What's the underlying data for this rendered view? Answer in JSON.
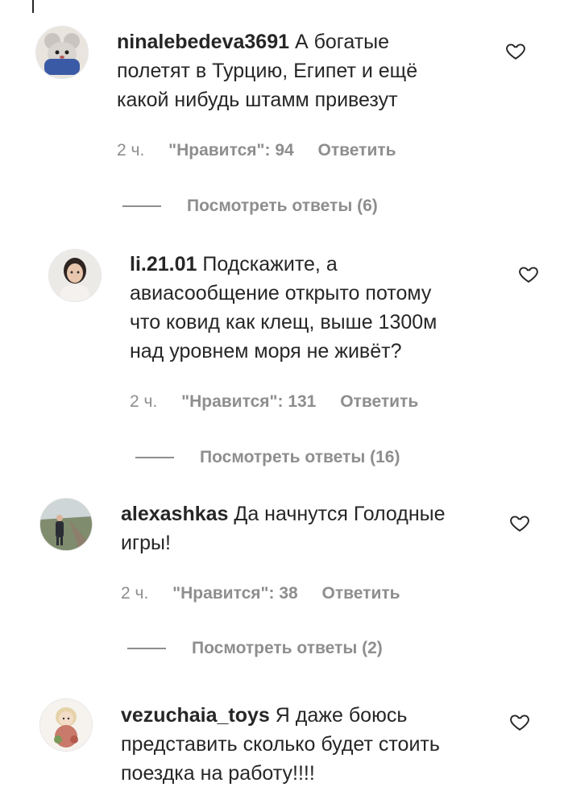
{
  "comments": [
    {
      "username": "ninalebedeva3691",
      "text_lines": [
        "А богатые",
        "полетят в Турцию, Египет и ещё",
        "какой нибудь штамм привезут"
      ],
      "time": "2 ч.",
      "likes": "\"Нравится\": 94",
      "reply": "Ответить",
      "view_replies": "Посмотреть ответы (6)",
      "avatar": "cartoon-mouse-avatar"
    },
    {
      "username": "li.21.01",
      "text_lines": [
        "Подскажите, а",
        "авиасообщение открыто потому",
        "что ковид как клещ, выше 1300м",
        "над уровнем моря не живёт?"
      ],
      "time": "2 ч.",
      "likes": "\"Нравится\": 131",
      "reply": "Ответить",
      "view_replies": "Посмотреть ответы (16)",
      "avatar": "woman-portrait-avatar"
    },
    {
      "username": "alexashkas",
      "text_lines": [
        "Да начнутся Голодные",
        "игры!"
      ],
      "time": "2 ч.",
      "likes": "\"Нравится\": 38",
      "reply": "Ответить",
      "view_replies": "Посмотреть ответы (2)",
      "avatar": "man-outdoors-avatar"
    },
    {
      "username": "vezuchaia_toys",
      "text_lines": [
        "Я даже боюсь",
        "представить сколько будет стоить",
        "поездка на работу!!!!"
      ],
      "avatar": "doll-toy-avatar"
    }
  ],
  "colors": {
    "text": "#262626",
    "secondary": "#8e8e8e",
    "background": "#ffffff"
  },
  "icons": {
    "like": "heart-outline-icon"
  }
}
